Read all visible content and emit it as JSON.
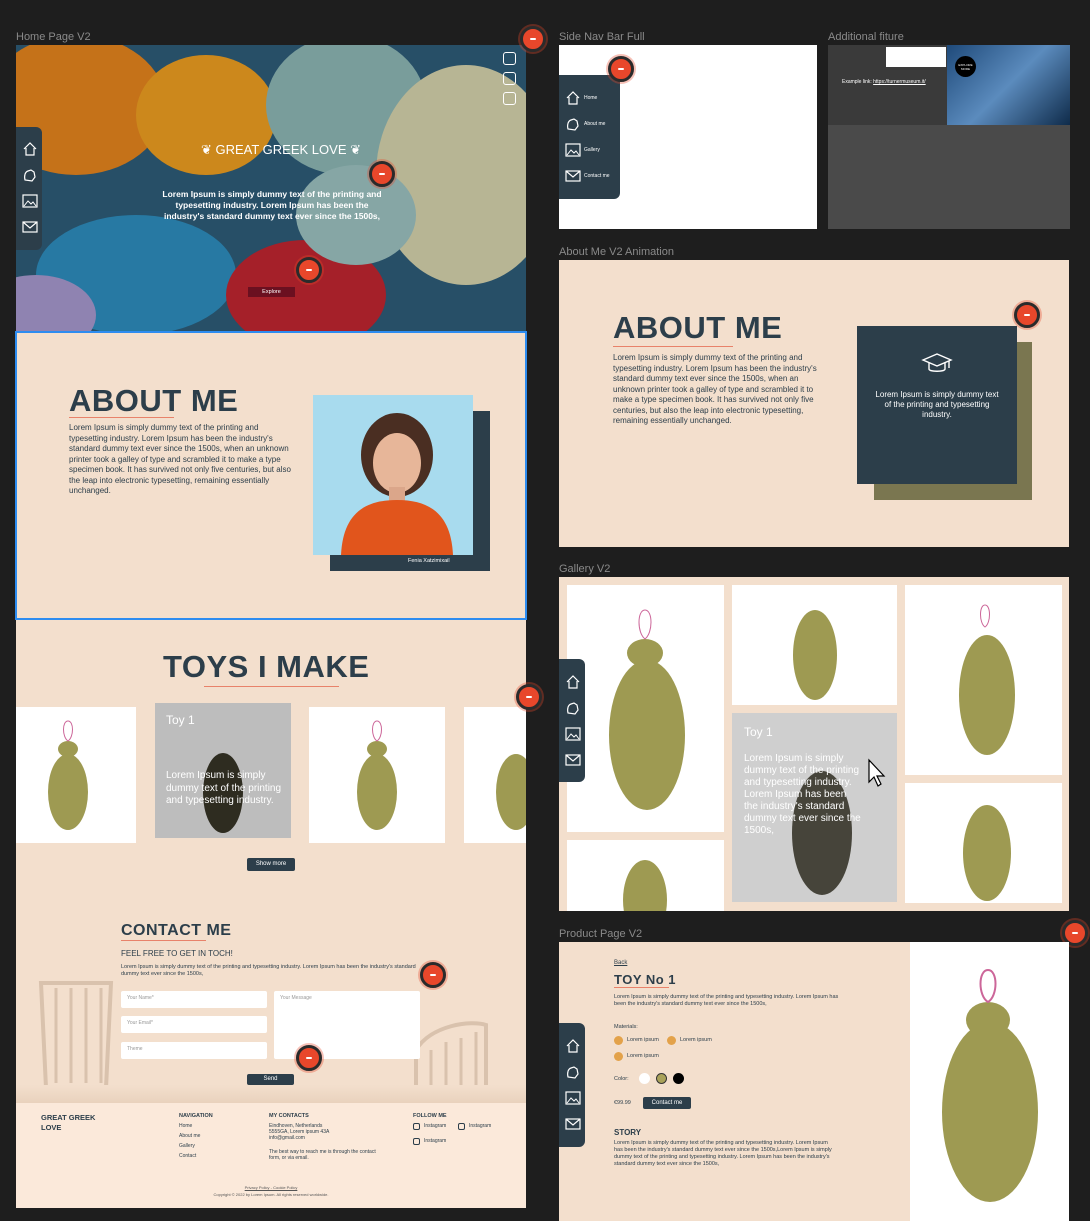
{
  "frames": {
    "home": "Home Page V2",
    "sidenav": "Side Nav Bar Full",
    "additional": "Additional fiture",
    "about_anim": "About Me V2 Animation",
    "gallery": "Gallery V2",
    "product": "Product Page V2"
  },
  "hero": {
    "title": "GREAT GREEK LOVE",
    "text": "Lorem Ipsum is simply dummy text of the printing and typesetting industry. Lorem Ipsum has been the industry's standard dummy text ever since the 1500s,",
    "button": "Explore"
  },
  "about": {
    "title": "ABOUT ME",
    "text": "Lorem Ipsum is simply dummy text of the printing and typesetting industry. Lorem Ipsum has been the industry's standard dummy text ever since the 1500s, when an unknown printer took a galley of type and scrambled it to make a type specimen book. It has survived not only five centuries, but also the leap into electronic typesetting, remaining essentially unchanged.",
    "caption": "Fenia Xatzimixail"
  },
  "toys": {
    "title": "TOYS I MAKE",
    "card_title": "Toy 1",
    "card_text": "Lorem Ipsum is simply dummy text of the printing and typesetting industry.",
    "button": "Show more"
  },
  "contact": {
    "title": "CONTACT ME",
    "subtitle": "FEEL FREE TO GET IN TOCH!",
    "text": "Lorem Ipsum is simply dummy text of the printing and typesetting industry. Lorem Ipsum has been the industry's standard dummy text ever since the 1500s,",
    "name_ph": "Your Name*",
    "email_ph": "Your Email*",
    "theme_ph": "Theme",
    "message_ph": "Your Message",
    "send": "Send"
  },
  "footer": {
    "brand": "GREAT GREEK LOVE",
    "nav_title": "NAVIGATION",
    "nav": [
      "Home",
      "About me",
      "Gallery",
      "Contact"
    ],
    "contacts_title": "MY CONTACTS",
    "address": "Eindhoven, Netherlands 5555GA, Lorem ipsum 43A info@gmail.com",
    "reach": "The best way to reach me is through the contact form, or via email.",
    "follow_title": "FOLLOW ME",
    "instagram": "Instagram",
    "links": "Privacy Policy - Cookie Policy",
    "copyright": "Copyright © 2022 by Lorem Ipsum. All rights reserved worldwide."
  },
  "sidenav": {
    "items": [
      "Home",
      "About me",
      "Gallery",
      "Contact me"
    ]
  },
  "additional": {
    "example_label": "Example link:",
    "example_url": "https://turnermuseum.it/",
    "badge": "EXPLORE MORE"
  },
  "about_anim": {
    "title": "ABOUT ME",
    "text": "Lorem Ipsum is simply dummy text of the printing and typesetting industry. Lorem Ipsum has been the industry's standard dummy text ever since the 1500s, when an unknown printer took a galley of type and scrambled it to make a type specimen book. It has survived not only five centuries, but also the leap into electronic typesetting, remaining essentially unchanged.",
    "card_text": "Lorem Ipsum is simply dummy text of the printing and typesetting industry."
  },
  "gallery": {
    "card_title": "Toy 1",
    "card_text": "Lorem Ipsum is simply dummy text of the printing and typesetting industry. Lorem Ipsum has been the industry's standard dummy text ever since the 1500s,"
  },
  "product": {
    "back": "Back",
    "title": "TOY No 1",
    "text": "Lorem Ipsum is simply dummy text of the printing and typesetting industry. Lorem Ipsum has been the industry's standard dummy text ever since the 1500s,",
    "materials_label": "Materials:",
    "material": "Lorem ipsum",
    "color_label": "Color:",
    "price": "€99.99",
    "contact_btn": "Contact me",
    "story_title": "STORY",
    "story": "Lorem Ipsum is simply dummy text of the printing and typesetting industry. Lorem Ipsum has been the industry's standard dummy text ever since the 1500s,Lorem Ipsum is simply dummy text of the printing and typesetting industry. Lorem Ipsum has been the industry's standard dummy text ever since the 1500s,",
    "colors": [
      "#ffffff",
      "#a9a25a",
      "#000000"
    ]
  },
  "colors": {
    "accent": "#e8472b",
    "navy": "#2c3e4a",
    "beige": "#f3dfcd",
    "olive": "#7a7650"
  }
}
